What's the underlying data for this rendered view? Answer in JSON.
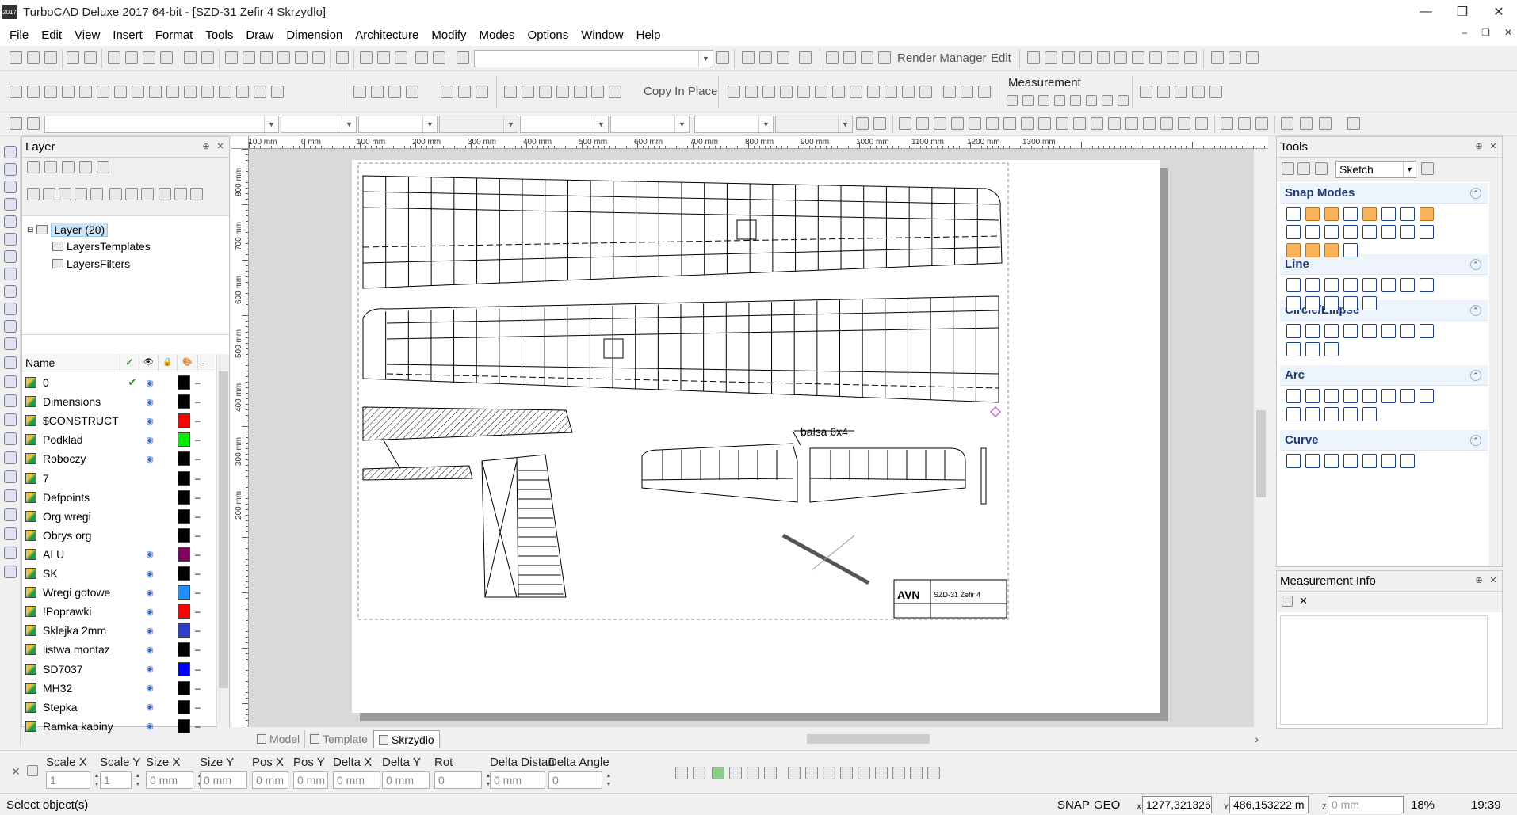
{
  "window": {
    "title": "TurboCAD Deluxe 2017 64-bit - [SZD-31 Zefir 4 Skrzydlo]",
    "icon_text": "2017",
    "minimize": "—",
    "maximize": "❐",
    "close": "✕",
    "mdi_minimize": "–",
    "mdi_restore": "❐",
    "mdi_close": "✕"
  },
  "menu": [
    "File",
    "Edit",
    "View",
    "Insert",
    "Format",
    "Tools",
    "Draw",
    "Dimension",
    "Architecture",
    "Modify",
    "Modes",
    "Options",
    "Window",
    "Help"
  ],
  "toolbar": {
    "render_manager": "Render Manager",
    "edit": "Edit",
    "copy_in_place": "Copy In Place",
    "measurement": "Measurement"
  },
  "layer_panel": {
    "title": "Layer",
    "tree": [
      {
        "label": "Layer (20)",
        "selected": true
      },
      {
        "label": "LayersTemplates"
      },
      {
        "label": "LayersFilters"
      }
    ],
    "columns": {
      "name": "Name",
      "current": "✓",
      "visible": "👁",
      "lock": "🔒",
      "color": "🎨",
      "more": "-"
    },
    "layers": [
      {
        "name": "0",
        "current": true,
        "visible": true,
        "color": "#000000"
      },
      {
        "name": "Dimensions",
        "current": false,
        "visible": true,
        "color": "#000000"
      },
      {
        "name": "$CONSTRUCT",
        "current": false,
        "visible": true,
        "color": "#ff0000"
      },
      {
        "name": "Podklad",
        "current": false,
        "visible": true,
        "color": "#00ee00"
      },
      {
        "name": "Roboczy",
        "current": false,
        "visible": true,
        "color": "#000000"
      },
      {
        "name": "7",
        "current": false,
        "visible": false,
        "color": "#000000"
      },
      {
        "name": "Defpoints",
        "current": false,
        "visible": false,
        "color": "#000000"
      },
      {
        "name": "Org wregi",
        "current": false,
        "visible": false,
        "color": "#000000"
      },
      {
        "name": "Obrys org",
        "current": false,
        "visible": false,
        "color": "#000000"
      },
      {
        "name": "ALU",
        "current": false,
        "visible": true,
        "color": "#800060"
      },
      {
        "name": "SK",
        "current": false,
        "visible": true,
        "color": "#000000"
      },
      {
        "name": "Wregi gotowe",
        "current": false,
        "visible": true,
        "color": "#1e90ff"
      },
      {
        "name": "!Poprawki",
        "current": false,
        "visible": true,
        "color": "#ff0000"
      },
      {
        "name": "Sklejka 2mm",
        "current": false,
        "visible": true,
        "color": "#2e3fcc"
      },
      {
        "name": "listwa montaz",
        "current": false,
        "visible": true,
        "color": "#000000"
      },
      {
        "name": "SD7037",
        "current": false,
        "visible": true,
        "color": "#0000ff"
      },
      {
        "name": "MH32",
        "current": false,
        "visible": true,
        "color": "#000000"
      },
      {
        "name": "Stepka",
        "current": false,
        "visible": true,
        "color": "#000000"
      },
      {
        "name": "Ramka kabiny",
        "current": false,
        "visible": true,
        "color": "#000000"
      }
    ]
  },
  "ruler": {
    "h_labels": [
      "-100 mm",
      "0 mm",
      "100 mm",
      "200 mm",
      "300 mm",
      "400 mm",
      "500 mm",
      "600 mm",
      "700 mm",
      "800 mm",
      "900 mm",
      "1000 mm",
      "1100 mm",
      "1200 mm",
      "1300 mm"
    ],
    "v_labels": [
      "800 mm",
      "700 mm",
      "600 mm",
      "500 mm",
      "400 mm",
      "300 mm",
      "200 mm"
    ]
  },
  "drawing": {
    "annotation": "balsa 6x4",
    "title_block_name": "SZD-31 Zefir 4",
    "title_block_logo": "AVN"
  },
  "sheet_tabs": [
    {
      "label": "Model",
      "active": false
    },
    {
      "label": "Template",
      "active": false
    },
    {
      "label": "Skrzydlo",
      "active": true
    }
  ],
  "tools_panel": {
    "title": "Tools",
    "mode_value": "Sketch",
    "sections": [
      "Snap Modes",
      "Line",
      "Circle/Ellipse",
      "Arc",
      "Curve"
    ]
  },
  "measurement_panel": {
    "title": "Measurement Info"
  },
  "inspector": {
    "fields": [
      {
        "label": "Scale X",
        "value": "1"
      },
      {
        "label": "Scale Y",
        "value": "1"
      },
      {
        "label": "Size X",
        "value": "0 mm"
      },
      {
        "label": "Size Y",
        "value": "0 mm"
      },
      {
        "label": "Pos X",
        "value": "0 mm"
      },
      {
        "label": "Pos Y",
        "value": "0 mm"
      },
      {
        "label": "Delta X",
        "value": "0 mm"
      },
      {
        "label": "Delta Y",
        "value": "0 mm"
      },
      {
        "label": "Rot",
        "value": "0"
      },
      {
        "label": "Delta Distan",
        "value": "0 mm"
      },
      {
        "label": "Delta Angle",
        "value": "0"
      }
    ]
  },
  "status": {
    "prompt": "Select object(s)",
    "snap": "SNAP",
    "geo": "GEO",
    "x_label": "X",
    "x_value": "1277,321326",
    "y_label": "Y",
    "y_value": "486,153222 m",
    "z_label": "Z",
    "z_value": "0 mm",
    "zoom": "18%",
    "time": "19:39"
  }
}
